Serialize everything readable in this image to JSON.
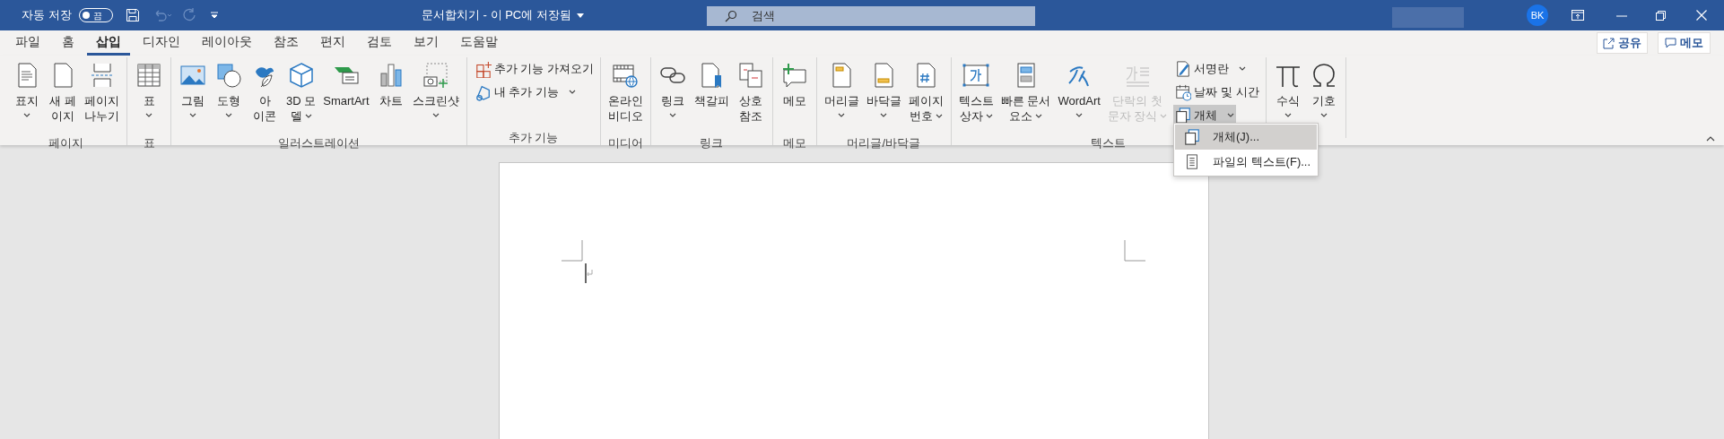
{
  "title_bar": {
    "autosave": {
      "label": "자동 저장",
      "on": false,
      "state_text": "끔"
    },
    "undo_enabled": false,
    "redo_enabled": false,
    "title": "문서합치기 - 이 PC에 저장됨",
    "search": {
      "placeholder": "검색"
    },
    "user_initials": "BK"
  },
  "tabs": [
    {
      "label": "파일",
      "selected": false
    },
    {
      "label": "홈",
      "selected": false
    },
    {
      "label": "삽입",
      "selected": true
    },
    {
      "label": "디자인",
      "selected": false
    },
    {
      "label": "레이아웃",
      "selected": false
    },
    {
      "label": "참조",
      "selected": false
    },
    {
      "label": "편지",
      "selected": false
    },
    {
      "label": "검토",
      "selected": false
    },
    {
      "label": "보기",
      "selected": false
    },
    {
      "label": "도움말",
      "selected": false
    }
  ],
  "share_button": "공유",
  "comments_button": "메모",
  "groups": [
    {
      "label": "페이지",
      "items": [
        {
          "kind": "large",
          "lines": [
            "표지"
          ],
          "dropdown": true,
          "disabled": false
        },
        {
          "kind": "large",
          "lines": [
            "새 페",
            "이지"
          ],
          "dropdown": false,
          "disabled": false
        },
        {
          "kind": "large",
          "lines": [
            "페이지",
            "나누기"
          ],
          "dropdown": false,
          "disabled": false
        }
      ]
    },
    {
      "label": "표",
      "items": [
        {
          "kind": "large",
          "lines": [
            "표"
          ],
          "dropdown": true,
          "disabled": false
        }
      ]
    },
    {
      "label": "일러스트레이션",
      "items": [
        {
          "kind": "large",
          "lines": [
            "그림"
          ],
          "dropdown": true,
          "disabled": false
        },
        {
          "kind": "large",
          "lines": [
            "도형"
          ],
          "dropdown": true,
          "disabled": false
        },
        {
          "kind": "large",
          "lines": [
            "아",
            "이콘"
          ],
          "dropdown": false,
          "disabled": false
        },
        {
          "kind": "large",
          "lines": [
            "3D 모",
            "델"
          ],
          "dropdown": true,
          "disabled": false
        },
        {
          "kind": "large",
          "lines": [
            "SmartArt"
          ],
          "dropdown": false,
          "disabled": false
        },
        {
          "kind": "large",
          "lines": [
            "차트"
          ],
          "dropdown": false,
          "disabled": false
        },
        {
          "kind": "large",
          "lines": [
            "스크린샷"
          ],
          "dropdown": true,
          "disabled": false
        }
      ]
    },
    {
      "label": "추가 기능",
      "items": [
        {
          "kind": "small",
          "label": "추가 기능 가져오기",
          "dropdown": false,
          "selected": false
        },
        {
          "kind": "small",
          "label": "내 추가 기능",
          "dropdown": true,
          "selected": false
        }
      ]
    },
    {
      "label": "미디어",
      "items": [
        {
          "kind": "large",
          "lines": [
            "온라인",
            "비디오"
          ],
          "dropdown": false,
          "disabled": false
        }
      ]
    },
    {
      "label": "링크",
      "items": [
        {
          "kind": "large",
          "lines": [
            "링크"
          ],
          "dropdown": true,
          "disabled": false
        },
        {
          "kind": "large",
          "lines": [
            "책갈피"
          ],
          "dropdown": false,
          "disabled": false
        },
        {
          "kind": "large",
          "lines": [
            "상호",
            "참조"
          ],
          "dropdown": false,
          "disabled": false
        }
      ]
    },
    {
      "label": "메모",
      "items": [
        {
          "kind": "large",
          "lines": [
            "메모"
          ],
          "dropdown": false,
          "disabled": false
        }
      ]
    },
    {
      "label": "머리글/바닥글",
      "items": [
        {
          "kind": "large",
          "lines": [
            "머리글"
          ],
          "dropdown": true,
          "disabled": false
        },
        {
          "kind": "large",
          "lines": [
            "바닥글"
          ],
          "dropdown": true,
          "disabled": false
        },
        {
          "kind": "large",
          "lines": [
            "페이지",
            "번호"
          ],
          "dropdown": true,
          "disabled": false
        }
      ]
    },
    {
      "label": "텍스트",
      "items": [
        {
          "kind": "large",
          "lines": [
            "텍스트",
            "상자"
          ],
          "dropdown": true,
          "disabled": false
        },
        {
          "kind": "large",
          "lines": [
            "빠른 문서",
            "요소"
          ],
          "dropdown": true,
          "disabled": false
        },
        {
          "kind": "large",
          "lines": [
            "WordArt"
          ],
          "dropdown": true,
          "disabled": false
        },
        {
          "kind": "large",
          "lines": [
            "단락의 첫",
            "문자 장식"
          ],
          "dropdown": true,
          "disabled": true
        },
        {
          "kind": "small",
          "label": "서명란",
          "dropdown": true,
          "selected": false
        },
        {
          "kind": "small",
          "label": "날짜 및 시간",
          "dropdown": false,
          "selected": false
        },
        {
          "kind": "small",
          "label": "개체",
          "dropdown": true,
          "selected": true
        }
      ]
    },
    {
      "items": [
        {
          "kind": "large",
          "lines": [
            "수식"
          ],
          "dropdown": true,
          "disabled": false
        },
        {
          "kind": "large",
          "lines": [
            "기호"
          ],
          "dropdown": true,
          "disabled": false
        }
      ]
    }
  ],
  "menu": {
    "items": [
      {
        "label": "개체(J)...",
        "selected": true
      },
      {
        "label": "파일의 텍스트(F)...",
        "selected": false
      }
    ]
  }
}
